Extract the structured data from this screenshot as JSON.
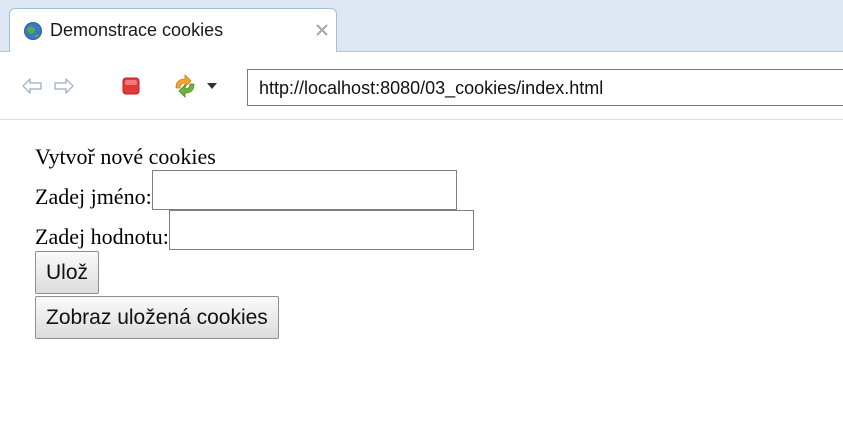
{
  "browser": {
    "tab_title": "Demonstrace cookies",
    "url": "http://localhost:8080/03_cookies/index.html",
    "icons": {
      "back": "back-arrow-icon",
      "forward": "forward-arrow-icon",
      "stop": "stop-icon",
      "refresh": "refresh-icon",
      "dropdown": "chevron-down-icon"
    }
  },
  "page": {
    "heading": "Vytvoř nové cookies",
    "name_label": "Zadej jméno:",
    "name_value": "",
    "value_label": "Zadej hodnotu:",
    "value_value": "",
    "save_button": "Ulož",
    "show_button": "Zobraz uložená cookies"
  },
  "colors": {
    "tabstrip_bg": "#dde7f3",
    "stop_red": "#e23a3a"
  }
}
